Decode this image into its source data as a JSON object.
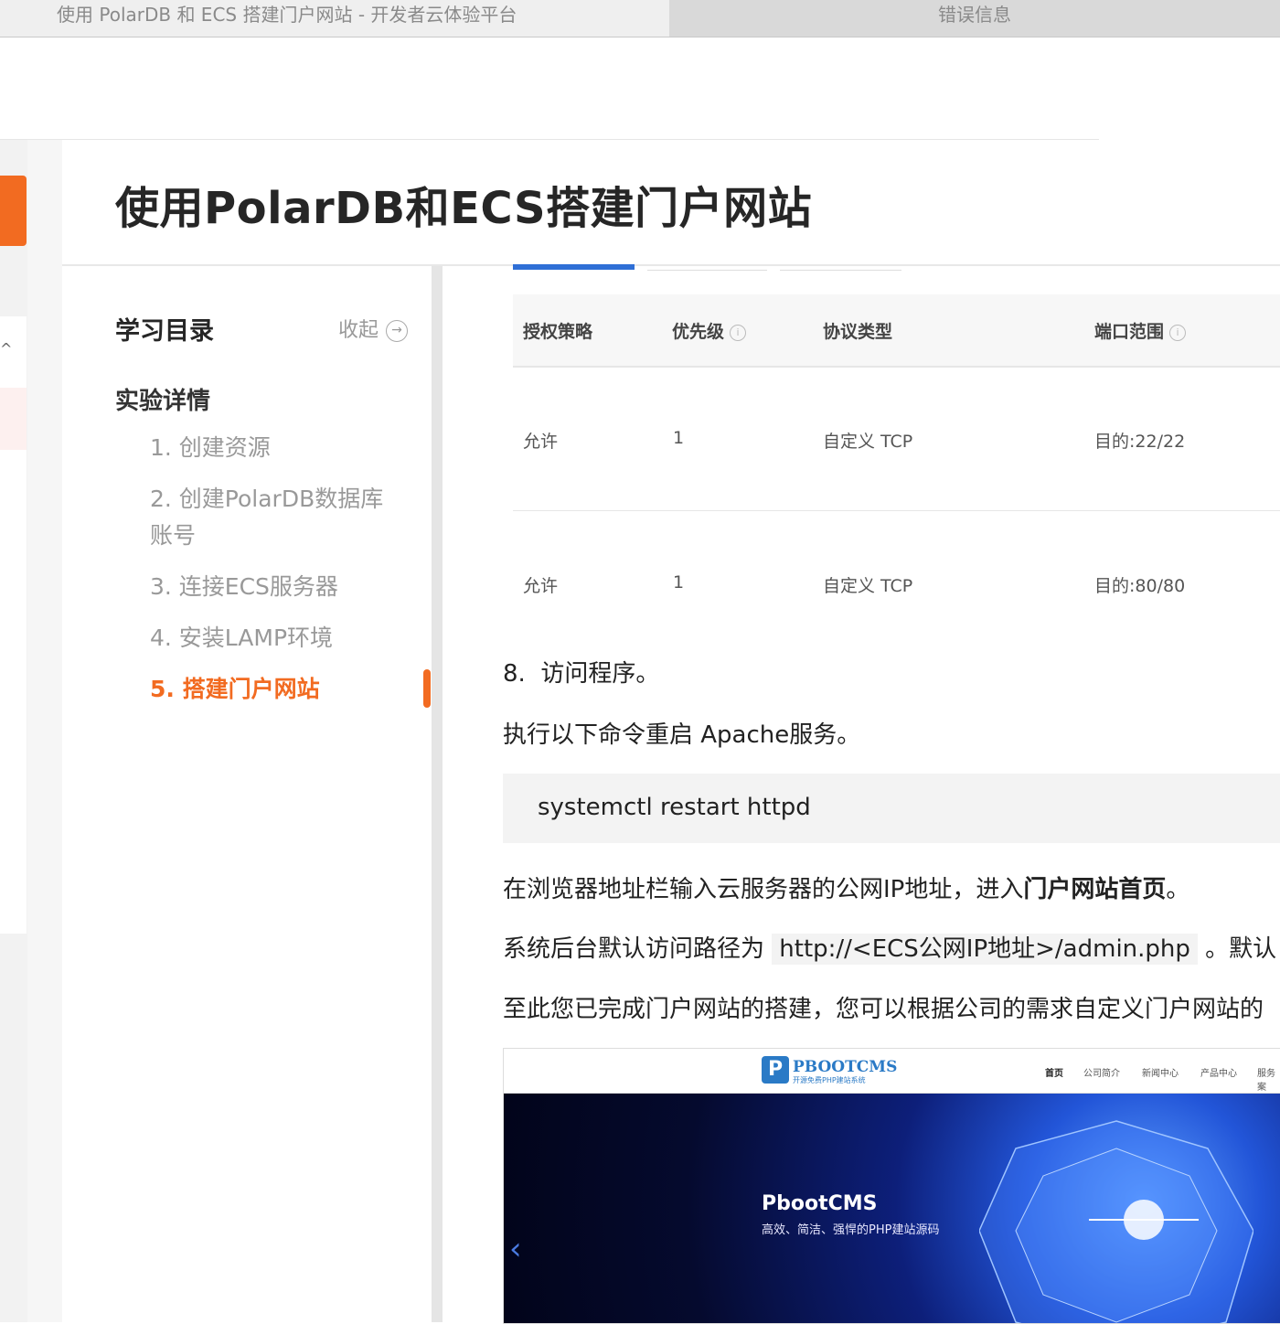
{
  "browser": {
    "active_tab": "使用 PolarDB 和 ECS 搭建门户网站 - 开发者云体验平台",
    "inactive_tab": "错误信息"
  },
  "page": {
    "title": "使用PolarDB和ECS搭建门户网站"
  },
  "sidebar": {
    "toc_title": "学习目录",
    "collapse_label": "收起",
    "section": "实验详情",
    "items": [
      {
        "label": "1. 创建资源",
        "active": false
      },
      {
        "label": "2. 创建PolarDB数据库",
        "label2": "账号",
        "active": false
      },
      {
        "label": "3. 连接ECS服务器",
        "active": false
      },
      {
        "label": "4. 安装LAMP环境",
        "active": false
      },
      {
        "label": "5. 搭建门户网站",
        "active": true
      }
    ]
  },
  "table": {
    "headers": [
      "授权策略",
      "优先级",
      "协议类型",
      "端口范围"
    ],
    "rows": [
      [
        "允许",
        "1",
        "自定义 TCP",
        "目的:22/22"
      ],
      [
        "允许",
        "1",
        "自定义 TCP",
        "目的:80/80"
      ]
    ]
  },
  "article": {
    "step_num": "8.",
    "step_title": "访问程序。",
    "restart_text": "执行以下命令重启 Apache服务。",
    "code": "systemctl restart httpd",
    "browser_text_a": "在浏览器地址栏输入云服务器的公网IP地址，进入",
    "browser_text_b": "门户网站首页",
    "browser_text_c": "。",
    "admin_text_a": "系统后台默认访问路径为 ",
    "admin_url": "http://<ECS公网IP地址>/admin.php",
    "admin_text_c": " 。默认",
    "done_text": "至此您已完成门户网站的搭建，您可以根据公司的需求自定义门户网站的"
  },
  "screenshot": {
    "logo_text": "PBOOTCMS",
    "logo_sub": "开源免费PHP建站系统",
    "nav": [
      "首页",
      "公司简介",
      "新闻中心",
      "产品中心",
      "服务案"
    ],
    "hero_title": "PbootCMS",
    "hero_sub": "高效、简洁、强悍的PHP建站源码"
  },
  "colors": {
    "accent": "#f26b21",
    "text_dark": "#262626",
    "muted": "#999999"
  }
}
